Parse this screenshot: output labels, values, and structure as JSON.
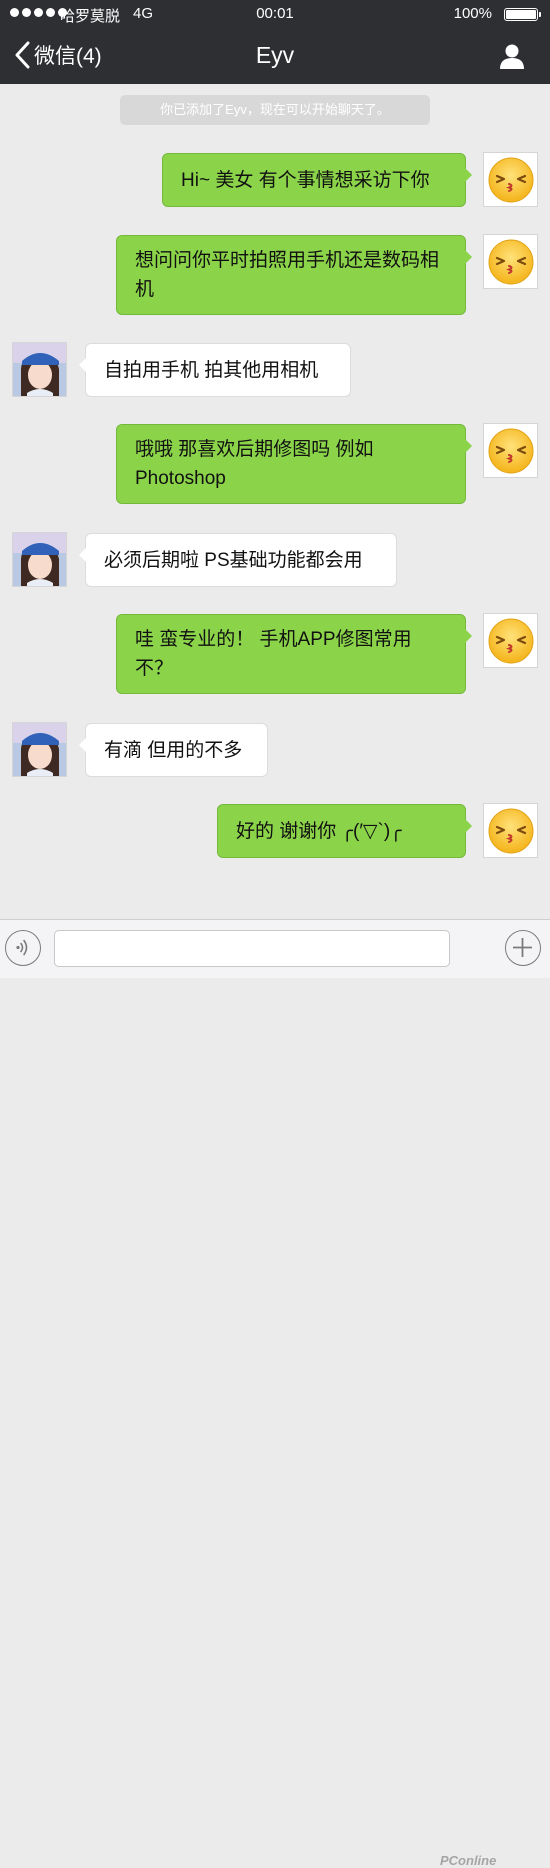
{
  "status_bar": {
    "carrier": "哈罗莫脱",
    "network": "4G",
    "time": "00:01",
    "battery_percent": "100%",
    "signal_dots_filled": 5,
    "battery_level": 1.0
  },
  "nav": {
    "back_label": "微信(4)",
    "title": "Eyv",
    "back_icon": "chevron-left-icon",
    "user_icon": "user-profile-icon"
  },
  "chat": {
    "system_notice": "你已添加了Eyv，现在可以开始聊天了。",
    "messages": [
      {
        "sender": "me",
        "text": "Hi~ 美女 有个事情想采访下你"
      },
      {
        "sender": "me",
        "text": "想问问你平时拍照用手机还是数码相机"
      },
      {
        "sender": "them",
        "text": "自拍用手机 拍其他用相机"
      },
      {
        "sender": "me",
        "text": "哦哦 那喜欢后期修图吗 例如Photoshop"
      },
      {
        "sender": "them",
        "text": "必须后期啦 PS基础功能都会用"
      },
      {
        "sender": "me",
        "text": "哇 蛮专业的！ 手机APP修图常用不？"
      },
      {
        "sender": "them",
        "text": "有滴 但用的不多"
      },
      {
        "sender": "me",
        "text": "好的 谢谢你 ╭(′▽`)╭"
      }
    ]
  },
  "input_bar": {
    "voice_icon": "voice-input-icon",
    "plus_icon": "plus-icon",
    "watermark": "PConline"
  },
  "colors": {
    "nav_bg": "#2e2f33",
    "chat_bg": "#ebebeb",
    "my_bubble": "#8bd44a",
    "their_bubble": "#ffffff"
  }
}
